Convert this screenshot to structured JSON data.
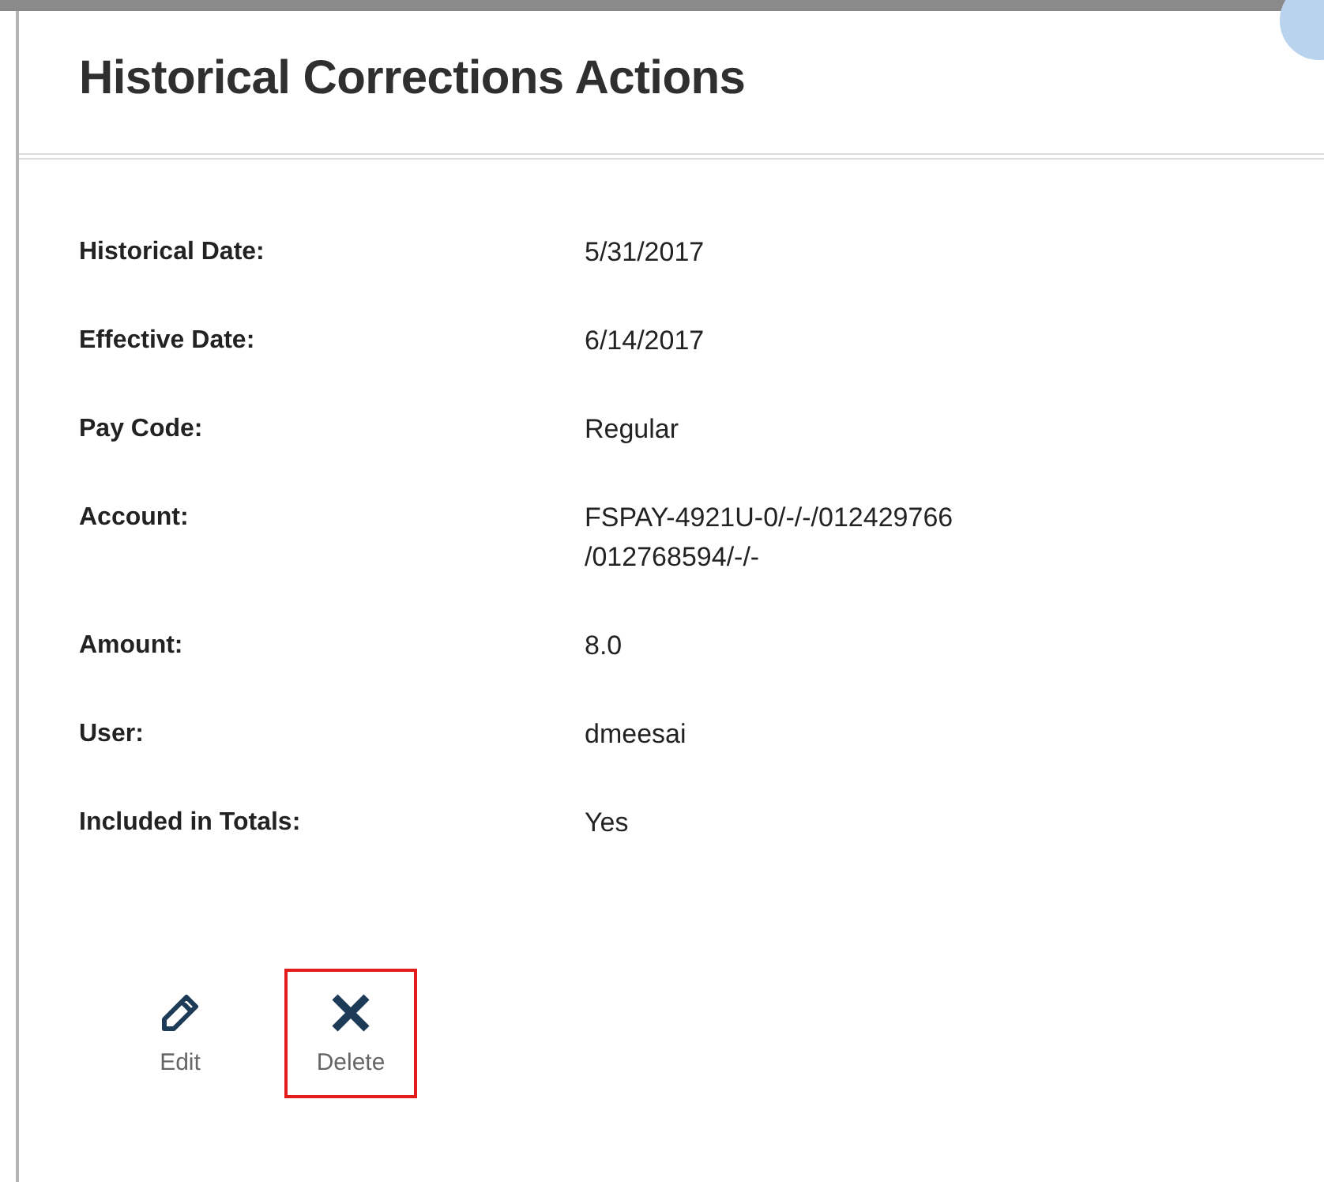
{
  "dialog": {
    "title": "Historical Corrections Actions"
  },
  "fields": [
    {
      "label": "Historical Date:",
      "value": "5/31/2017"
    },
    {
      "label": "Effective Date:",
      "value": "6/14/2017"
    },
    {
      "label": "Pay Code:",
      "value": "Regular"
    },
    {
      "label": "Account:",
      "value": "FSPAY-4921U-0/-/-/012429766 /012768594/-/-"
    },
    {
      "label": "Amount:",
      "value": "8.0"
    },
    {
      "label": "User:",
      "value": "dmeesai"
    },
    {
      "label": "Included in Totals:",
      "value": "Yes"
    }
  ],
  "actions": [
    {
      "kind": "edit",
      "label": "Edit",
      "selected": false
    },
    {
      "kind": "delete",
      "label": "Delete",
      "selected": true
    }
  ]
}
